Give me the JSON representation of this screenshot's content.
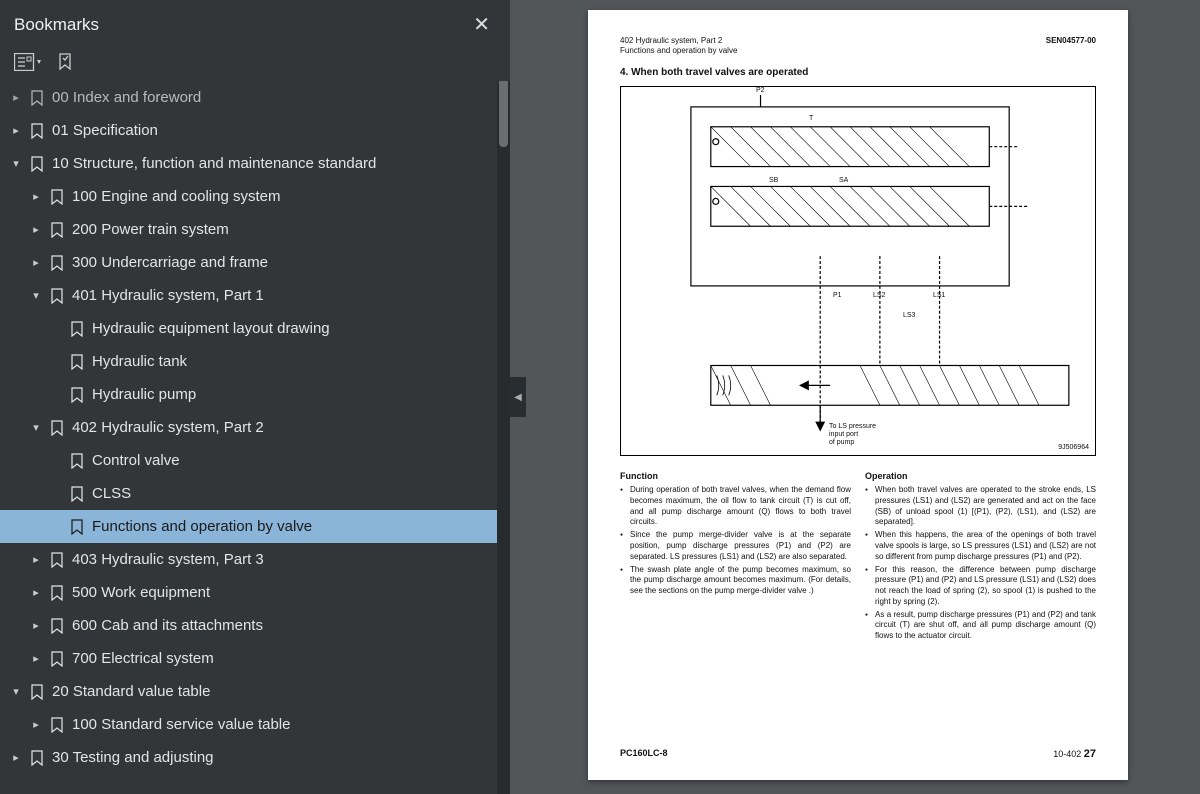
{
  "sidebar": {
    "title": "Bookmarks",
    "items": [
      {
        "indent": 0,
        "chev": "right",
        "label": "00 Index and foreword",
        "dim": true
      },
      {
        "indent": 0,
        "chev": "right",
        "label": "01 Specification"
      },
      {
        "indent": 0,
        "chev": "down",
        "label": "10 Structure, function and maintenance standard"
      },
      {
        "indent": 1,
        "chev": "right",
        "label": "100 Engine and cooling system"
      },
      {
        "indent": 1,
        "chev": "right",
        "label": "200 Power train system"
      },
      {
        "indent": 1,
        "chev": "right",
        "label": "300 Undercarriage and frame"
      },
      {
        "indent": 1,
        "chev": "down",
        "label": "401 Hydraulic system, Part 1"
      },
      {
        "indent": 2,
        "chev": "none",
        "label": "Hydraulic equipment layout drawing"
      },
      {
        "indent": 2,
        "chev": "none",
        "label": "Hydraulic tank"
      },
      {
        "indent": 2,
        "chev": "none",
        "label": "Hydraulic pump"
      },
      {
        "indent": 1,
        "chev": "down",
        "label": "402 Hydraulic system, Part 2"
      },
      {
        "indent": 2,
        "chev": "none",
        "label": "Control valve"
      },
      {
        "indent": 2,
        "chev": "none",
        "label": "CLSS"
      },
      {
        "indent": 2,
        "chev": "none",
        "label": "Functions and operation by valve",
        "selected": true
      },
      {
        "indent": 1,
        "chev": "right",
        "label": "403 Hydraulic system, Part 3"
      },
      {
        "indent": 1,
        "chev": "right",
        "label": "500 Work equipment"
      },
      {
        "indent": 1,
        "chev": "right",
        "label": "600 Cab and its attachments"
      },
      {
        "indent": 1,
        "chev": "right",
        "label": "700 Electrical system"
      },
      {
        "indent": 0,
        "chev": "down",
        "label": "20 Standard value table"
      },
      {
        "indent": 1,
        "chev": "right",
        "label": "100 Standard service value table"
      },
      {
        "indent": 0,
        "chev": "right",
        "label": "30 Testing and adjusting"
      }
    ]
  },
  "page": {
    "header_left1": "402 Hydraulic system, Part 2",
    "header_left2": "Functions and operation by valve",
    "header_right": "SEN04577-00",
    "section_title": "4.   When both travel valves are operated",
    "diagram_labels": {
      "p2": "P2",
      "t": "T",
      "sb": "SB",
      "sa": "SA",
      "p1": "P1",
      "ls2": "LS2",
      "ls1": "LS1",
      "ls3": "LS3",
      "note1": "To LS pressure",
      "note2": "input port",
      "note3": "of pump",
      "code": "9J506964"
    },
    "col1_title": "Function",
    "col1_items": [
      "During operation of both travel valves, when the demand flow becomes maximum, the oil flow to tank circuit (T) is cut off, and all pump discharge amount (Q) flows to both travel circuits.",
      "Since the pump merge-divider valve is at the separate position, pump discharge pressures (P1) and (P2) are separated. LS pressures (LS1) and (LS2) are also separated.",
      "The swash plate angle of the pump becomes maximum, so the pump discharge amount becomes maximum. (For details, see the sections on the pump merge-divider valve .)"
    ],
    "col2_title": "Operation",
    "col2_items": [
      "When both travel valves are operated to the stroke ends, LS pressures (LS1) and (LS2) are generated and act on the face (SB) of unload spool (1) [(P1), (P2), (LS1), and (LS2) are separated].",
      "When this happens, the area of the openings of both travel valve spools is large, so LS pressures (LS1) and (LS2) are not so different from pump discharge pressures (P1) and (P2).",
      "For this reason, the difference between pump discharge pressure (P1) and (P2) and LS pressure (LS1) and (LS2) does not reach the load of spring (2), so spool (1) is pushed to the right by spring (2).",
      "As a result, pump discharge pressures (P1) and (P2) and tank circuit (T) are shut off, and all pump discharge amount (Q) flows to the actuator circuit."
    ],
    "footer_left": "PC160LC-8",
    "footer_right_prefix": "10-402",
    "footer_right_page": "27"
  }
}
